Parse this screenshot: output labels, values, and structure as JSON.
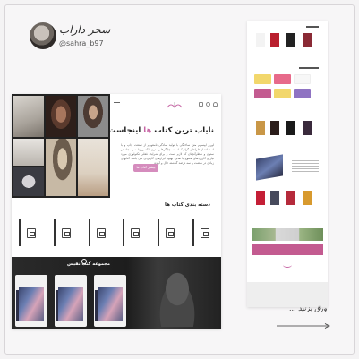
{
  "author": {
    "signature": "سحر داراب",
    "handle": "@sahra_b97"
  },
  "hero": {
    "title_main": "نایاب ترین کتاب ",
    "title_accent": "ها",
    "title_tail": " اینجاست",
    "description": "لورم ایپسوم متن ساختگی با تولید سادگی نامفهوم از صنعت چاپ و با استفاده از طراحان گرافیک است. چاپگرها و متون بلکه روزنامه و مجله در ستون و سطرآنچنان که لازم است و برای شرایط فعلی تکنولوژی مورد نیاز و کاربردهای متنوع با هدف بهبود ابزارهای کاربردی می باشد کتابهای زیادی در شصت و سه درصد گذشته حال و آینده",
    "button_label": "بیشتر کتاب ها"
  },
  "categories": {
    "title": "دسته بندی کتاب ها",
    "count": 6
  },
  "collection": {
    "title": "مجموعه کتب نفیس"
  },
  "caption": "ورق بزنید ...",
  "colors": {
    "accent": "#c766a5",
    "button": "#d58cbd",
    "dark": "#1f1f1f",
    "page": "#f4f3f4"
  },
  "icons": [
    "menu-icon",
    "cart-icon",
    "search-icon",
    "user-icon",
    "book-icon",
    "arrow-right-icon"
  ]
}
